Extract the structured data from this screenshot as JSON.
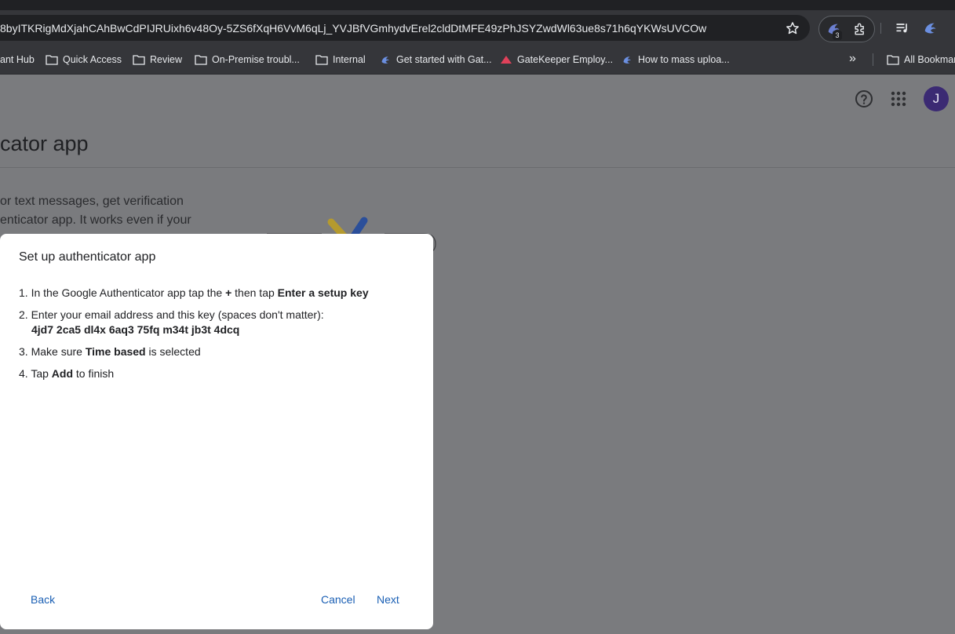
{
  "browser": {
    "url": "8byITKRigMdXjahCAhBwCdPIJRUixh6v48Oy-5ZS6fXqH6VvM6qLj_YVJBfVGmhydvErel2cldDtMFE49zPhJSYZwdWl63ue8s71h6qYKWsUVCOw",
    "extensions_badge": "3",
    "bookmarks": [
      {
        "label": "ant Hub",
        "icon": "none"
      },
      {
        "label": "Quick Access",
        "icon": "folder-icon"
      },
      {
        "label": "Review",
        "icon": "folder-icon"
      },
      {
        "label": "On-Premise troubl...",
        "icon": "folder-icon"
      },
      {
        "label": "Internal",
        "icon": "folder-icon"
      },
      {
        "label": "Get started with Gat...",
        "icon": "gatekeeper-logo-icon"
      },
      {
        "label": "GateKeeper Employ...",
        "icon": "gatekeeper-red-logo-icon"
      },
      {
        "label": "How to mass uploa...",
        "icon": "gatekeeper-logo-icon"
      }
    ],
    "more_bookmarks": "»",
    "all_bookmarks": "All Bookmar"
  },
  "page": {
    "title": "cator app",
    "description_lines": [
      "or text messages, get verification",
      "enticator app. It works even if your"
    ],
    "avatar_letter": "J"
  },
  "dialog": {
    "title": "Set up authenticator app",
    "step1": {
      "num": "1.",
      "a": "In the Google Authenticator app tap the ",
      "b1": "+",
      "c": " then tap ",
      "b2": "Enter a setup key"
    },
    "step2": {
      "num": "2.",
      "a": "Enter your email address and this key (spaces don't matter):",
      "key": "4jd7 2ca5 dl4x 6aq3 75fq m34t jb3t 4dcq"
    },
    "step3": {
      "num": "3.",
      "a": "Make sure ",
      "b": "Time based",
      "c": " is selected"
    },
    "step4": {
      "num": "4.",
      "a": "Tap ",
      "b": "Add",
      "c": " to finish"
    },
    "back_label": "Back",
    "cancel_label": "Cancel",
    "next_label": "Next"
  },
  "colors": {
    "scrim": "#7a7b7e",
    "link": "#1a5fb4",
    "avatar": "#3b2a73"
  }
}
